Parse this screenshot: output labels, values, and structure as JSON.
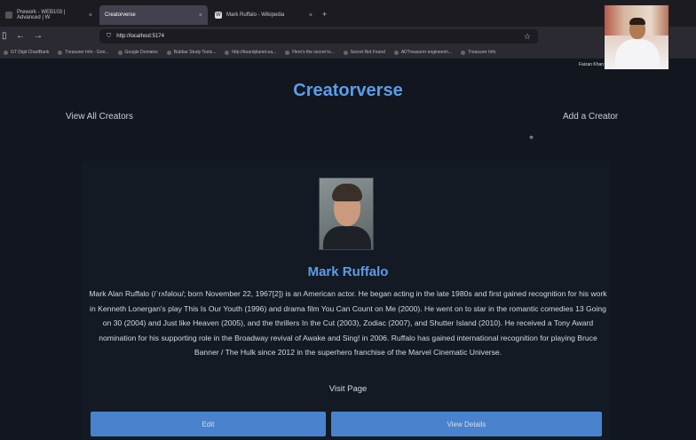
{
  "browser": {
    "tabs": [
      {
        "label": "Prework - WEB103 | Advanced | W",
        "active": false
      },
      {
        "label": "Creatorverse",
        "active": true
      },
      {
        "label": "Mark Ruffalo - Wikipedia",
        "active": false
      }
    ],
    "url": "http://localhost:5174",
    "bookmarks": [
      "GT Digit ChartBank",
      "Treasurer Info - Goo...",
      "Google Domains",
      "Bubbur Study Tools...",
      "http://boardplanet.ea...",
      "Here's the secret to...",
      "Secret Not Found",
      "ADTreasurer engineerin...",
      "Treasurer Info"
    ]
  },
  "webcam": {
    "name": "Faizan Khan"
  },
  "app": {
    "title": "Creatorverse",
    "nav": {
      "view_all": "View All Creators",
      "add": "Add a Creator"
    }
  },
  "creator": {
    "name": "Mark Ruffalo",
    "bio": "Mark Alan Ruffalo (/ˈrʌfəloʊ/; born November 22, 1967[2]) is an American actor. He began acting in the late 1980s and first gained recognition for his work in Kenneth Lonergan's play This Is Our Youth (1996) and drama film You Can Count on Me (2000). He went on to star in the romantic comedies 13 Going on 30 (2004) and Just like Heaven (2005), and the thrillers In the Cut (2003), Zodiac (2007), and Shutter Island (2010). He received a Tony Award nomination for his supporting role in the Broadway revival of Awake and Sing! in 2006. Ruffalo has gained international recognition for playing Bruce Banner / The Hulk since 2012 in the superhero franchise of the Marvel Cinematic Universe.",
    "visit_label": "Visit Page",
    "edit_label": "Edit",
    "view_details_label": "View Details"
  },
  "colors": {
    "accent": "#5b9de8",
    "button": "#4f8fe0",
    "background": "#11161f"
  }
}
